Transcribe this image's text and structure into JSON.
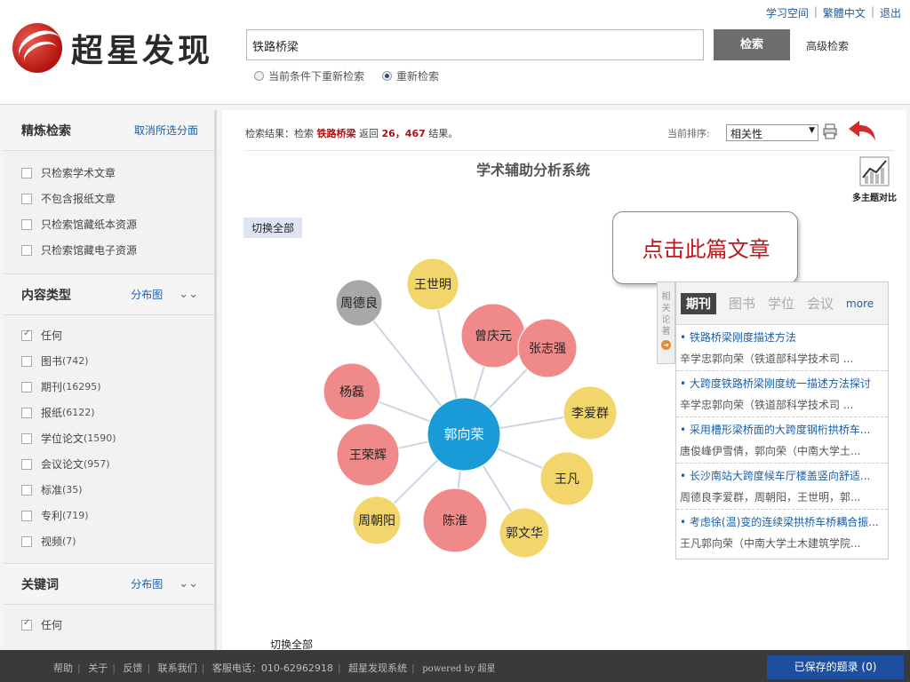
{
  "header": {
    "logo_text": "超星发现",
    "top_links": [
      "学习空间",
      "繁體中文",
      "退出"
    ],
    "search_value": "铁路桥梁",
    "search_button": "检索",
    "advanced_link": "高级检索",
    "radio_options": [
      {
        "label": "当前条件下重新检索",
        "selected": false
      },
      {
        "label": "重新检索",
        "selected": true
      }
    ]
  },
  "sidebar": {
    "refine": {
      "title": "精炼检索",
      "link": "取消所选分面",
      "items": [
        "只检索学术文章",
        "不包含报纸文章",
        "只检索馆藏纸本资源",
        "只检索馆藏电子资源"
      ]
    },
    "content_type": {
      "title": "内容类型",
      "link": "分布图",
      "items": [
        {
          "label": "任何",
          "count": "",
          "checked": true
        },
        {
          "label": "图书",
          "count": "(742)",
          "checked": false
        },
        {
          "label": "期刊",
          "count": "(16295)",
          "checked": false
        },
        {
          "label": "报纸",
          "count": "(6122)",
          "checked": false
        },
        {
          "label": "学位论文",
          "count": "(1590)",
          "checked": false
        },
        {
          "label": "会议论文",
          "count": "(957)",
          "checked": false
        },
        {
          "label": "标准",
          "count": "(35)",
          "checked": false
        },
        {
          "label": "专利",
          "count": "(719)",
          "checked": false
        },
        {
          "label": "视频",
          "count": "(7)",
          "checked": false
        }
      ]
    },
    "keywords": {
      "title": "关键词",
      "link": "分布图",
      "items": [
        {
          "label": "任何",
          "count": "",
          "checked": true
        }
      ]
    }
  },
  "main": {
    "result_prefix": "检索结果：检索",
    "result_keyword": "铁路桥梁",
    "result_mid": "返回",
    "result_count": "26，467",
    "result_suffix": "结果。",
    "sort_label": "当前排序:",
    "sort_value": "相关性",
    "analysis_title": "学术辅助分析系统",
    "compare_label": "多主题对比",
    "switch_all_top": "切换全部",
    "switch_all_bottom": "切换全部"
  },
  "network": {
    "center": {
      "name": "郭向荣",
      "color": "#1a9ad6"
    },
    "nodes": [
      {
        "name": "周德良",
        "color": "#a8a8a8"
      },
      {
        "name": "王世明",
        "color": "#f2d66b"
      },
      {
        "name": "曾庆元",
        "color": "#f08a8a"
      },
      {
        "name": "张志强",
        "color": "#f08a8a"
      },
      {
        "name": "杨磊",
        "color": "#f08a8a"
      },
      {
        "name": "李爱群",
        "color": "#f2d66b"
      },
      {
        "name": "王荣辉",
        "color": "#f08a8a"
      },
      {
        "name": "王凡",
        "color": "#f2d66b"
      },
      {
        "name": "周朝阳",
        "color": "#f2d66b"
      },
      {
        "name": "陈淮",
        "color": "#f08a8a"
      },
      {
        "name": "郭文华",
        "color": "#f2d66b"
      }
    ]
  },
  "callout": {
    "text": "点击此篇文章"
  },
  "related": {
    "side_tab": "相关论著",
    "tabs": [
      "期刊",
      "图书",
      "学位",
      "会议"
    ],
    "more": "more",
    "items": [
      {
        "title": "铁路桥梁刚度描述方法",
        "meta": "辛学忠郭向荣（铁道部科学技术司 ..."
      },
      {
        "title": "大跨度铁路桥梁刚度统一描述方法探讨",
        "meta": "辛学忠郭向荣（铁道部科学技术司 ..."
      },
      {
        "title": "采用槽形梁桥面的大跨度钢桁拱桥车...",
        "meta": "唐俊峰伊雪倩，郭向荣（中南大学土..."
      },
      {
        "title": "长沙南站大跨度候车厅楼盖竖向舒适...",
        "meta": "周德良李爱群，周朝阳，王世明，郭..."
      },
      {
        "title": "考虑徐(温)变的连续梁拱桥车桥耦合振...",
        "meta": "王凡郭向荣（中南大学土木建筑学院..."
      }
    ]
  },
  "footer": {
    "links": [
      "帮助",
      "关于",
      "反馈",
      "联系我们",
      "客服电话：010-62962918",
      "超星发现系统"
    ],
    "powered": "powered by 超星",
    "saved": "已保存的题录 (0)"
  },
  "colors": {
    "brand_red": "#c0141b",
    "link_blue": "#1a5fa8",
    "footer_bg": "#3a3a3a",
    "saved_blue": "#1d4f9e"
  }
}
